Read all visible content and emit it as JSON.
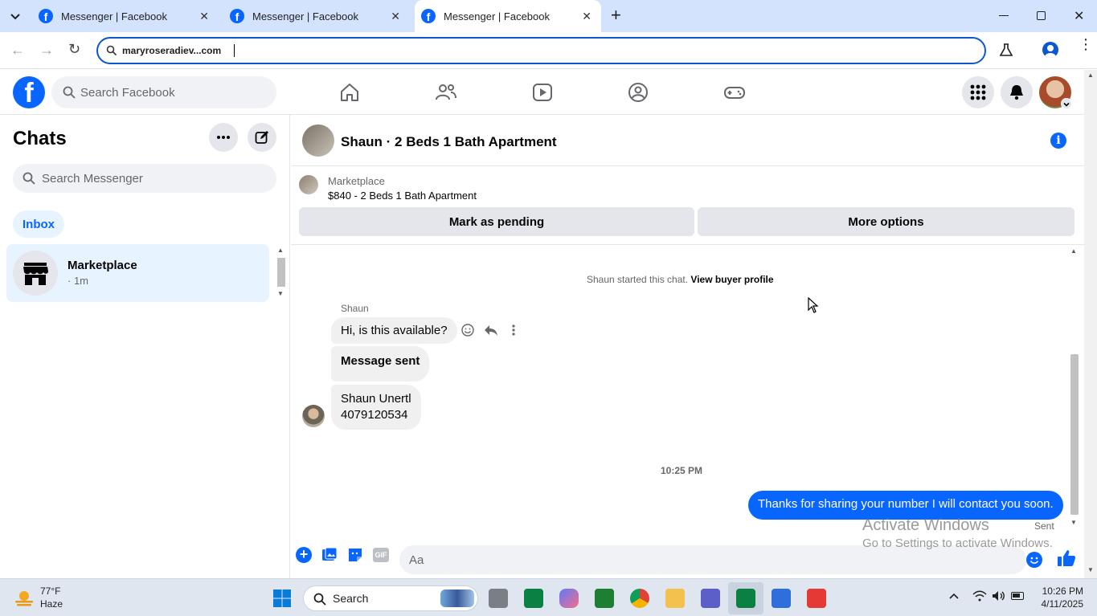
{
  "browser": {
    "tabs": [
      {
        "title": "Messenger | Facebook",
        "active": false
      },
      {
        "title": "Messenger | Facebook",
        "active": false
      },
      {
        "title": "Messenger | Facebook",
        "active": true
      }
    ],
    "address": "maryroseradiev...com",
    "new_tab": "+"
  },
  "fb": {
    "logo": "f",
    "search_placeholder": "Search Facebook"
  },
  "sidebar": {
    "title": "Chats",
    "search_placeholder": "Search Messenger",
    "filter": "Inbox",
    "chats": [
      {
        "name": "Marketplace",
        "meta": "· 1m"
      }
    ]
  },
  "conversation": {
    "title": "Shaun · 2 Beds 1 Bath Apartment",
    "listing": {
      "label": "Marketplace",
      "detail": "$840 - 2 Beds 1 Bath Apartment",
      "mark_pending": "Mark as pending",
      "more_options": "More options"
    },
    "system_note": "Shaun started this chat.",
    "system_link": "View buyer profile",
    "sender_name": "Shaun",
    "messages_in": [
      "Hi, is this available?",
      "Message sent",
      "Shaun Unertl",
      "4079120534"
    ],
    "timestamp": "10:25 PM",
    "message_out": "Thanks for sharing your number I will contact you soon.",
    "status": "Sent",
    "composer_placeholder": "Aa",
    "gif_label": "GIF"
  },
  "watermark": {
    "line1": "Activate Windows",
    "line2": "Go to Settings to activate Windows."
  },
  "taskbar": {
    "weather_temp": "77°F",
    "weather_desc": "Haze",
    "search_label": "Search",
    "time": "10:26 PM",
    "date": "4/11/2025"
  },
  "colors": {
    "fb_blue": "#0866ff",
    "active_chat_bg": "#e7f3ff"
  }
}
